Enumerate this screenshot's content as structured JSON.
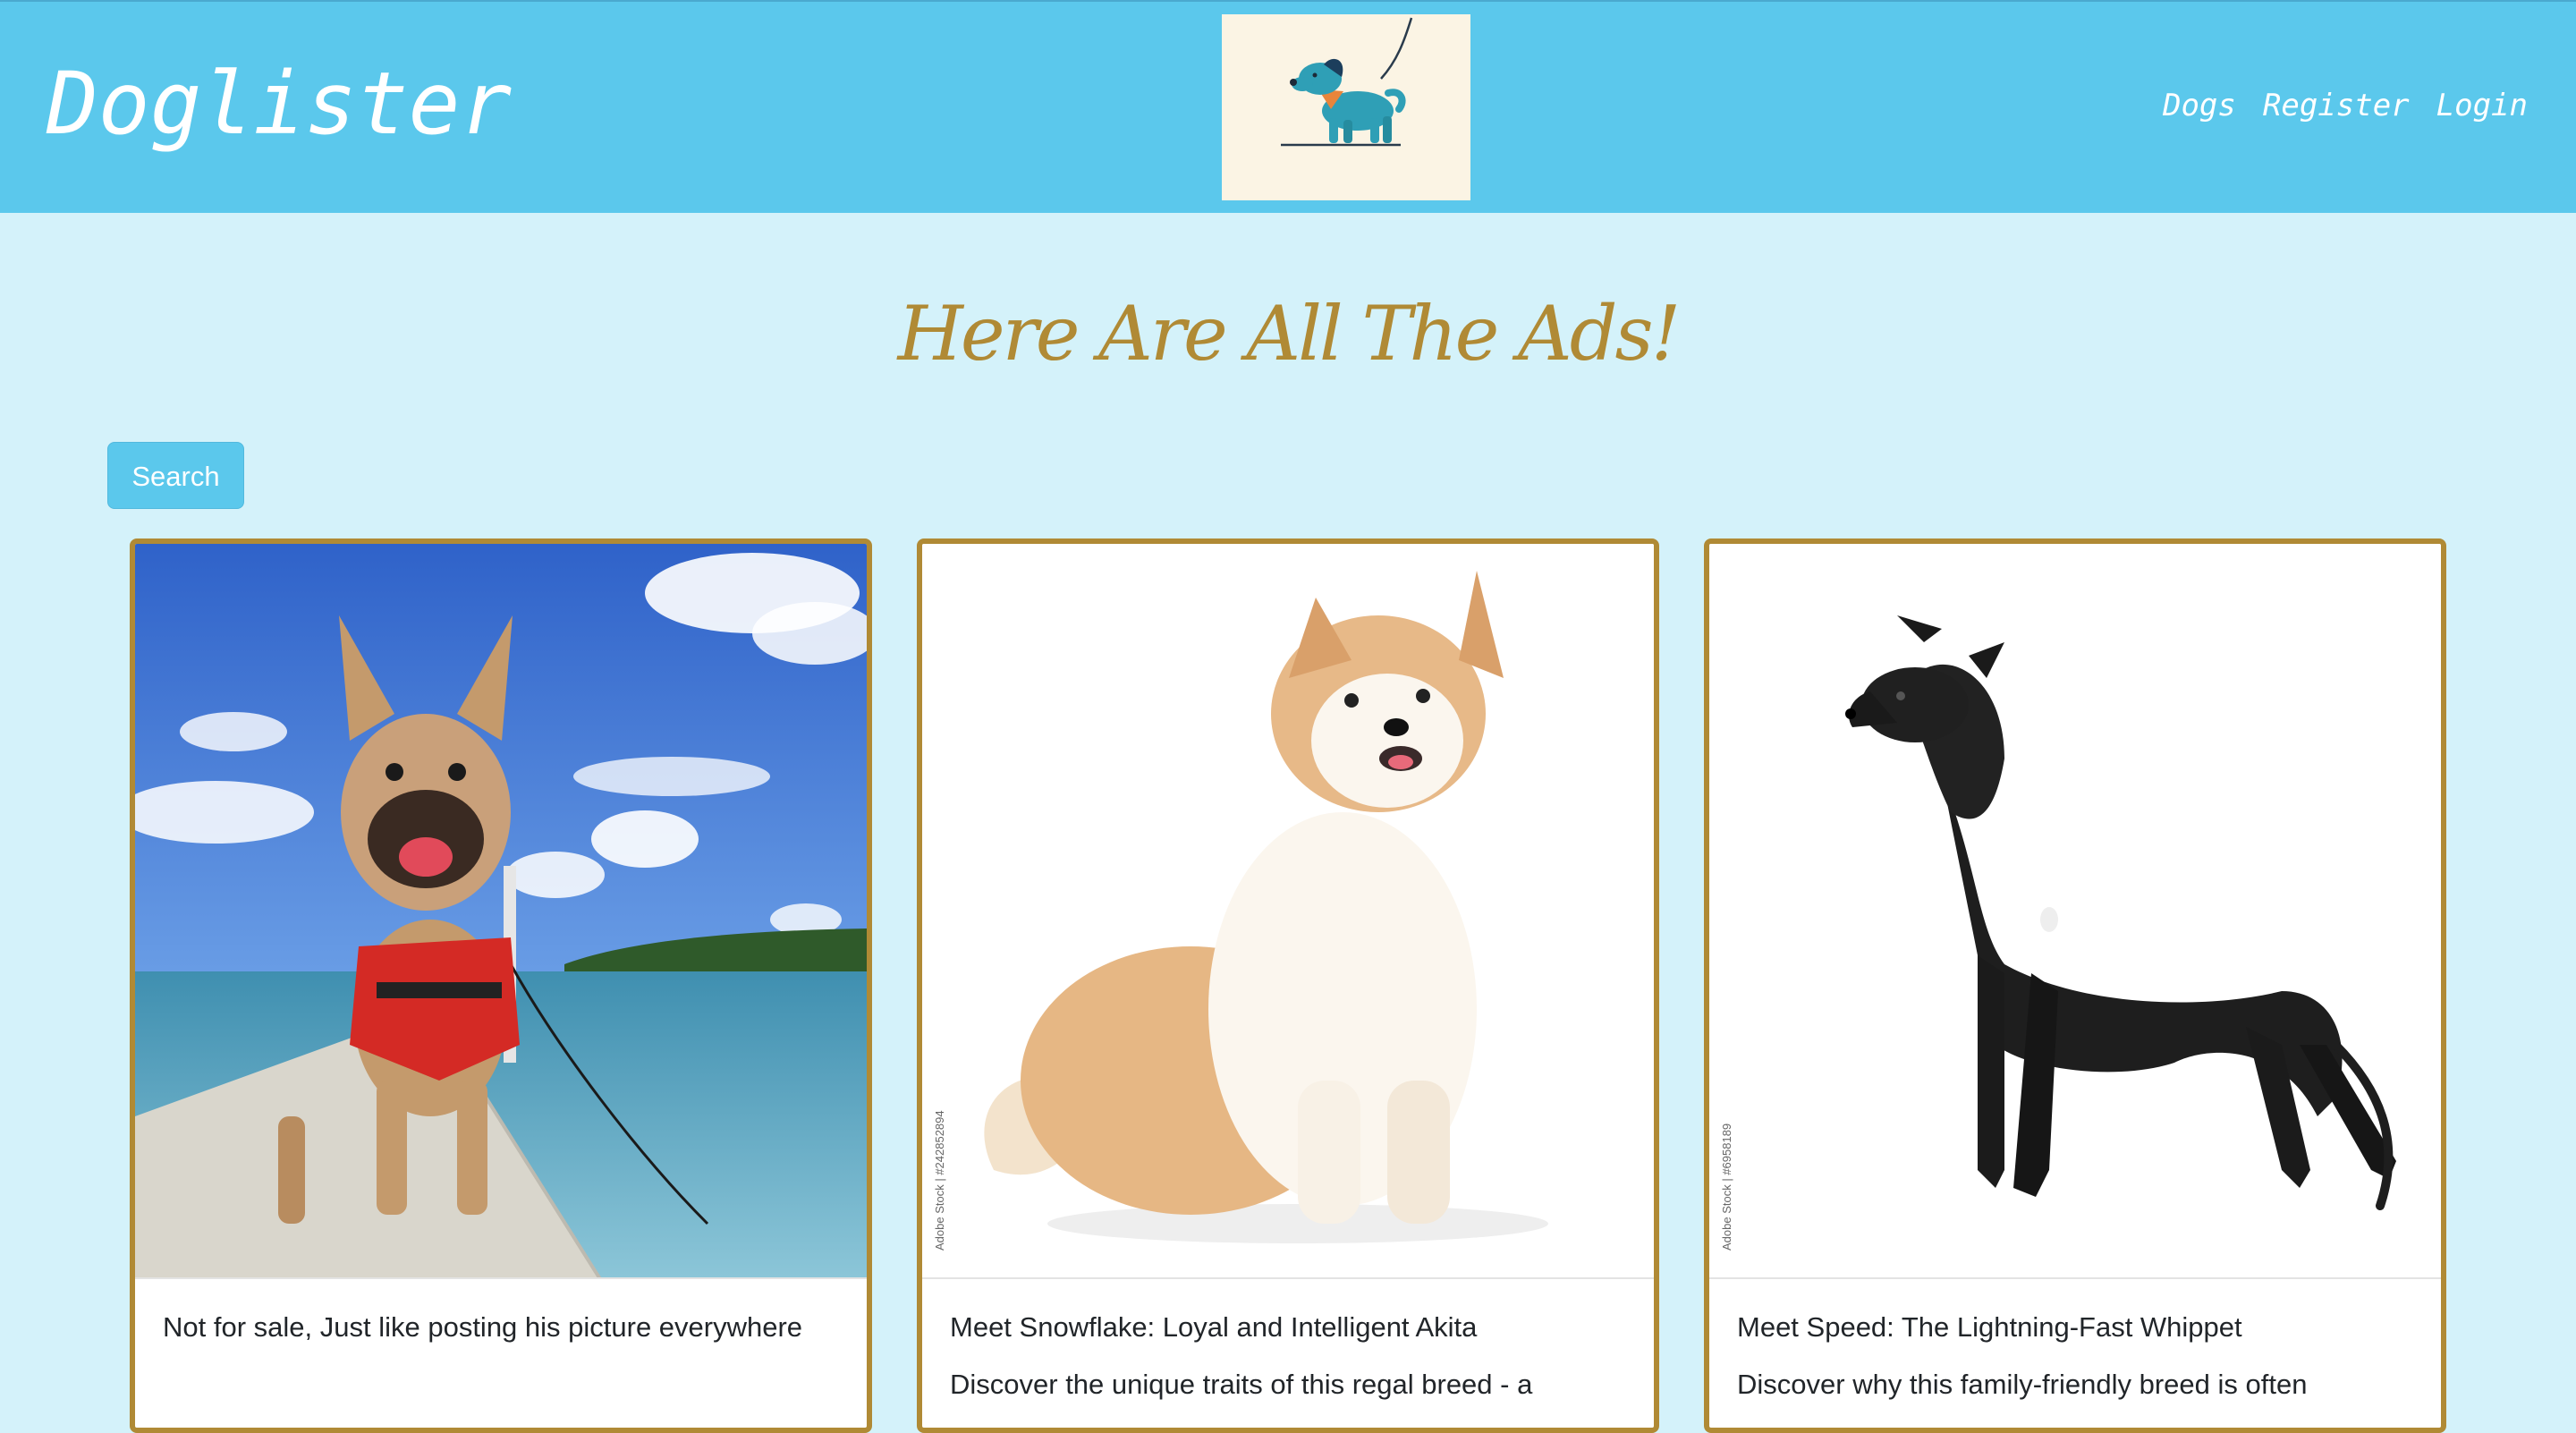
{
  "navbar": {
    "brand": "Doglister",
    "links": [
      "Dogs",
      "Register",
      "Login"
    ]
  },
  "page": {
    "heading": "Here Are All The Ads!",
    "search_label": "Search"
  },
  "cards": [
    {
      "title": "Not for sale, Just like posting his picture everywhere",
      "text": ""
    },
    {
      "title": "Meet Snowflake: Loyal and Intelligent Akita",
      "text": "Discover the unique traits of this regal breed - a",
      "watermark": "Adobe Stock | #242852894"
    },
    {
      "title": "Meet Speed: The Lightning-Fast Whippet",
      "text": "Discover why this family-friendly breed is often",
      "watermark": "Adobe Stock | #6958189"
    }
  ],
  "colors": {
    "navbar": "#5bc8ec",
    "background": "#d4f2fa",
    "accent_gold": "#b08a35"
  }
}
